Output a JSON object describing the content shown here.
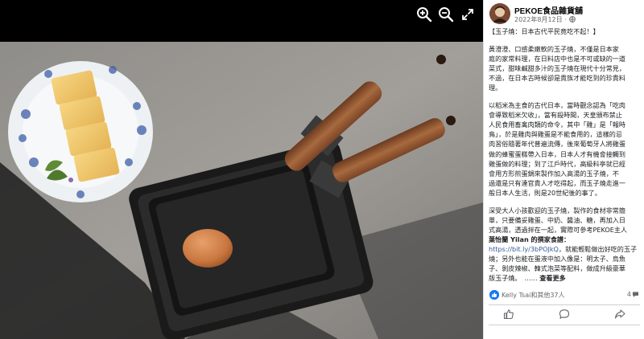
{
  "viewer": {
    "icons": [
      "zoom-in-icon",
      "zoom-out-icon",
      "fullscreen-icon"
    ],
    "photo_subject": "tamagoyaki-pans-photo"
  },
  "post": {
    "page_name": "PEKOE食品雜貨舖",
    "date": "2022年8月12日 ·",
    "paragraph1": [
      "【玉子燒：日本古代平民竟吃不起！】"
    ],
    "paragraph2": [
      "黃澄澄、口感柔嫩軟的玉子燒，不僅是日本家",
      "庭的家常料理，在日料店中也是不可或缺的一道",
      "菜式，甜味鹹甜多汁的玉子燒在現代十分常見，",
      "不過，在日本古時候卻是貴族才能吃到的珍貴料",
      "理。"
    ],
    "paragraph3": [
      "以稻米為主食的古代日本，當時觀念認為「吃肉",
      "會導致稻米欠收」，當有殺時間，天皇頒布禁止",
      "人民食用畜禽肉類的命令，其中「雞」是「報時",
      "鳥」，於是雞肉與雞蛋是不能食用的，這樣的忌",
      "肉習俗隨著年代普遍流傳，後來葡萄牙人將雞蛋",
      "做的蜂蜜蛋糕帶入日本，日本人才有機會接觸到",
      "雞蛋做的料理；到了江戶時代，高級料亭就已經",
      "會用方形煎蛋鍋來製作加入高湯的玉子燒，不",
      "過還是只有達官貴人才吃得起，而玉子燒走進一",
      "般日本人生活，則是20世紀後的事了。"
    ],
    "paragraph4": [
      "深受大人小孩歡迎的玉子燒，製作的食材非常簡",
      "單，只要備妥雞蛋、中奶、醬油、糖，再加入日",
      "式高湯，透過拌在一起，實際可參考PEKOE主人"
    ],
    "paragraph4_bold": "葉怡蘭 Yilan 的撰家食譜：",
    "link": "https://bit.ly/3bPOJkQ",
    "link_suffix": "，就能輕鬆做出好吃的玉子",
    "paragraph4_rest": [
      "燒；另外也能在蛋液中加入像是：明太子、烏魚",
      "子、剝皮辣椒、韓式泡菜等配料，做成升級豪華"
    ],
    "paragraph4_last": "版玉子燒。　",
    "ellipsis": "……",
    "see_more": "查看更多"
  },
  "engagement": {
    "reaction_names": "Kelly Tsai和其他37人",
    "comment_count": "4",
    "like_color": "#1877f2"
  },
  "actions": [
    "like-icon",
    "comment-icon",
    "share-icon"
  ],
  "colors": {
    "link": "#385898",
    "muted_text": "#65676b",
    "text": "#1c1e21",
    "viewer_bg": "#000000"
  }
}
